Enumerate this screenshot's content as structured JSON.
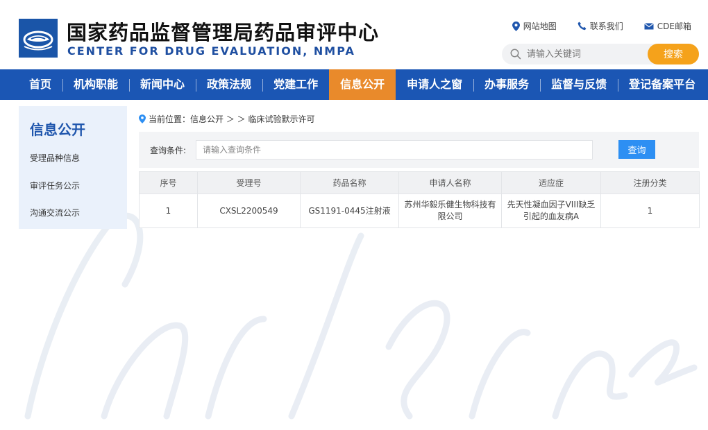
{
  "header": {
    "title_cn": "国家药品监督管理局药品审评中心",
    "title_en": "CENTER FOR DRUG EVALUATION, NMPA",
    "links": [
      {
        "label": "网站地图",
        "icon": "location-pin-icon"
      },
      {
        "label": "联系我们",
        "icon": "phone-icon"
      },
      {
        "label": "CDE邮箱",
        "icon": "mail-icon"
      }
    ],
    "search": {
      "placeholder": "请输入关键词",
      "button": "搜索"
    }
  },
  "nav": {
    "items": [
      "首页",
      "机构职能",
      "新闻中心",
      "政策法规",
      "党建工作",
      "信息公开",
      "申请人之窗",
      "办事服务",
      "监督与反馈",
      "登记备案平台"
    ],
    "active_index": 5
  },
  "sidebar": {
    "title": "信息公开",
    "items": [
      "受理品种信息",
      "审评任务公示",
      "沟通交流公示"
    ]
  },
  "breadcrumb": {
    "text": "当前位置：信息公开 ＞ ＞ 临床试验默示许可"
  },
  "query": {
    "label": "查询条件:",
    "placeholder": "请输入查询条件",
    "button": "查询"
  },
  "table": {
    "headers": [
      "序号",
      "受理号",
      "药品名称",
      "申请人名称",
      "适应症",
      "注册分类"
    ],
    "rows": [
      [
        "1",
        "CXSL2200549",
        "GS1191-0445注射液",
        "苏州华毅乐健生物科技有限公司",
        "先天性凝血因子VIII缺乏引起的血友病A",
        "1"
      ]
    ]
  },
  "colors": {
    "nav_bg": "#1b56b4",
    "nav_active": "#e98a2b",
    "search_button": "#f5a21b",
    "query_button": "#2d8ff3",
    "brand_blue": "#1f4fa1"
  }
}
